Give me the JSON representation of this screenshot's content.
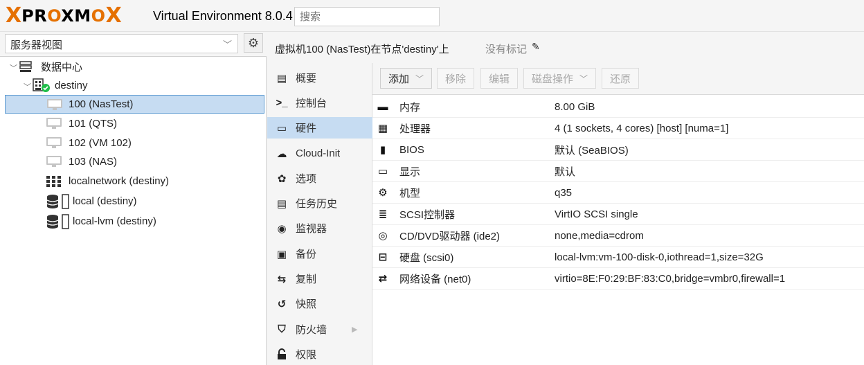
{
  "header": {
    "logo_x": "X",
    "logo_word_1": "PR",
    "logo_word_o1": "O",
    "logo_word_2": "XM",
    "logo_word_o2": "O",
    "logo_x2": "X",
    "version": "Virtual Environment 8.0.4",
    "search_placeholder": "搜索"
  },
  "left": {
    "view_select": "服务器视图",
    "tree": [
      {
        "label": "数据中心",
        "icon": "server-rack-icon"
      },
      {
        "label": "destiny",
        "icon": "node-online-icon"
      },
      {
        "label": "100 (NasTest)",
        "icon": "vm-monitor-icon",
        "selected": true
      },
      {
        "label": "101 (QTS)",
        "icon": "vm-monitor-icon"
      },
      {
        "label": "102 (VM 102)",
        "icon": "vm-monitor-icon"
      },
      {
        "label": "103 (NAS)",
        "icon": "vm-monitor-icon"
      },
      {
        "label": "localnetwork (destiny)",
        "icon": "network-grid-icon"
      },
      {
        "label": "local (destiny)",
        "icon": "storage-icon"
      },
      {
        "label": "local-lvm (destiny)",
        "icon": "storage-icon"
      }
    ]
  },
  "right": {
    "title": "虚拟机100 (NasTest)在节点'destiny'上",
    "no_tags": "没有标记",
    "nav": [
      {
        "label": "概要",
        "icon": "book-icon",
        "glyph": "▤"
      },
      {
        "label": "控制台",
        "icon": "terminal-icon",
        "glyph": ">_"
      },
      {
        "label": "硬件",
        "icon": "desktop-icon",
        "glyph": "▭",
        "active": true
      },
      {
        "label": "Cloud-Init",
        "icon": "cloud-icon",
        "glyph": "☁"
      },
      {
        "label": "选项",
        "icon": "gear-icon",
        "glyph": "✿"
      },
      {
        "label": "任务历史",
        "icon": "list-icon",
        "glyph": "▤"
      },
      {
        "label": "监视器",
        "icon": "eye-icon",
        "glyph": "◉"
      },
      {
        "label": "备份",
        "icon": "floppy-icon",
        "glyph": "▣"
      },
      {
        "label": "复制",
        "icon": "retweet-icon",
        "glyph": "⇆"
      },
      {
        "label": "快照",
        "icon": "history-icon",
        "glyph": "↺"
      },
      {
        "label": "防火墙",
        "icon": "shield-icon",
        "glyph": "⛉"
      },
      {
        "label": "权限",
        "icon": "unlock-icon",
        "glyph": "🔓"
      }
    ],
    "toolbar": {
      "add": "添加",
      "remove": "移除",
      "edit": "编辑",
      "disk_action": "磁盘操作",
      "revert": "还原"
    },
    "hardware": [
      {
        "key": "内存",
        "value": "8.00 GiB",
        "icon": "memory-icon",
        "glyph": "▬"
      },
      {
        "key": "处理器",
        "value": "4 (1 sockets, 4 cores) [host] [numa=1]",
        "icon": "cpu-icon",
        "glyph": "▦"
      },
      {
        "key": "BIOS",
        "value": "默认 (SeaBIOS)",
        "icon": "microchip-icon",
        "glyph": "▮"
      },
      {
        "key": "显示",
        "value": "默认",
        "icon": "desktop-icon",
        "glyph": "▭"
      },
      {
        "key": "机型",
        "value": "q35",
        "icon": "cogs-icon",
        "glyph": "⚙"
      },
      {
        "key": "SCSI控制器",
        "value": "VirtIO SCSI single",
        "icon": "database-icon",
        "glyph": "≣"
      },
      {
        "key": "CD/DVD驱动器 (ide2)",
        "value": "none,media=cdrom",
        "icon": "cdrom-icon",
        "glyph": "◎"
      },
      {
        "key": "硬盘 (scsi0)",
        "value": "local-lvm:vm-100-disk-0,iothread=1,size=32G",
        "icon": "hdd-icon",
        "glyph": "⊟"
      },
      {
        "key": "网络设备 (net0)",
        "value": "virtio=8E:F0:29:BF:83:C0,bridge=vmbr0,firewall=1",
        "icon": "exchange-icon",
        "glyph": "⇄"
      }
    ]
  },
  "colors": {
    "brand_orange": "#e57000",
    "selection_bg": "#c6dcf2",
    "selection_border": "#5e9bd1",
    "online_green": "#21bf4b"
  }
}
